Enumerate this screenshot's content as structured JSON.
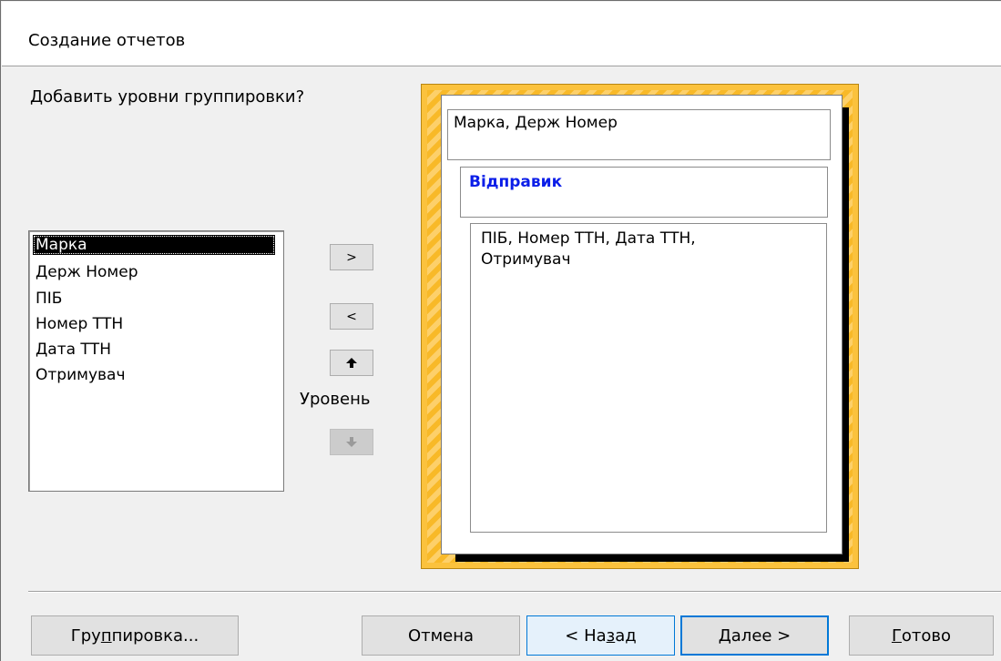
{
  "window": {
    "title": "Создание отчетов"
  },
  "prompt": {
    "question": "Добавить уровни группировки?"
  },
  "fields": {
    "items": [
      {
        "label": "Марка",
        "selected": true
      },
      {
        "label": "Держ Номер",
        "selected": false
      },
      {
        "label": "ПІБ",
        "selected": false
      },
      {
        "label": "Номер ТТН",
        "selected": false
      },
      {
        "label": "Дата ТТН",
        "selected": false
      },
      {
        "label": "Отримувач",
        "selected": false
      }
    ]
  },
  "controls": {
    "add_label": ">",
    "remove_label": "<",
    "level_label": "Уровень",
    "up_icon": "arrow-up-icon",
    "down_icon": "arrow-down-icon"
  },
  "preview": {
    "top_group": "Марка, Держ Номер",
    "group_title": "Відправик",
    "detail_line1": "ПІБ, Номер ТТН, Дата ТТН,",
    "detail_line2": "Отримувач"
  },
  "buttons": {
    "grouping": {
      "pre": "Гру",
      "u": "п",
      "post": "пировка..."
    },
    "cancel": "Отмена",
    "back": {
      "pre": "< На",
      "u": "з",
      "post": "ад"
    },
    "next": {
      "pre": "",
      "u": "Д",
      "post": "алее >"
    },
    "finish": {
      "pre": "",
      "u": "Г",
      "post": "отово"
    }
  },
  "colors": {
    "accent": "#0078d7",
    "group_title": "#0b1ee8",
    "preview_frame": "#fbc23d"
  }
}
